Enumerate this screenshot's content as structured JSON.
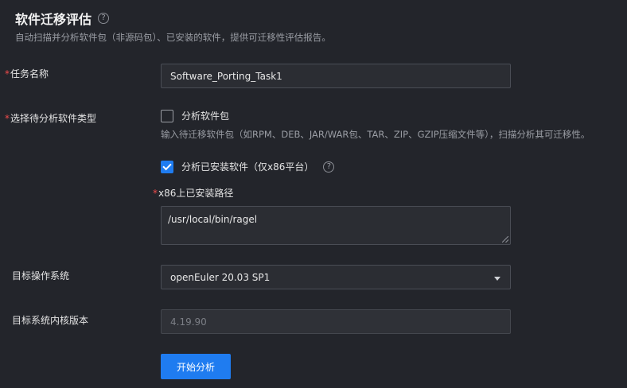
{
  "header": {
    "title": "软件迁移评估",
    "help_icon": "?",
    "subtitle": "自动扫描并分析软件包（非源码包）、已安装的软件，提供可迁移性评估报告。"
  },
  "form": {
    "required_mark": "*",
    "task_name": {
      "label": "任务名称",
      "value": "Software_Porting_Task1"
    },
    "analysis_type": {
      "label": "选择待分析软件类型",
      "package_option": {
        "label": "分析软件包",
        "checked": false,
        "hint": "输入待迁移软件包（如RPM、DEB、JAR/WAR包、TAR、ZIP、GZIP压缩文件等），扫描分析其可迁移性。"
      },
      "installed_option": {
        "label": "分析已安装软件（仅x86平台）",
        "checked": true,
        "help_icon": "?"
      }
    },
    "install_path": {
      "label": "x86上已安装路径",
      "value": "/usr/local/bin/ragel"
    },
    "target_os": {
      "label": "目标操作系统",
      "value": "openEuler 20.03 SP1"
    },
    "kernel_version": {
      "label": "目标系统内核版本",
      "value": "4.19.90"
    },
    "submit_label": "开始分析"
  },
  "colors": {
    "background": "#23252b",
    "accent": "#1f7cf0",
    "required": "#f04b4b"
  }
}
